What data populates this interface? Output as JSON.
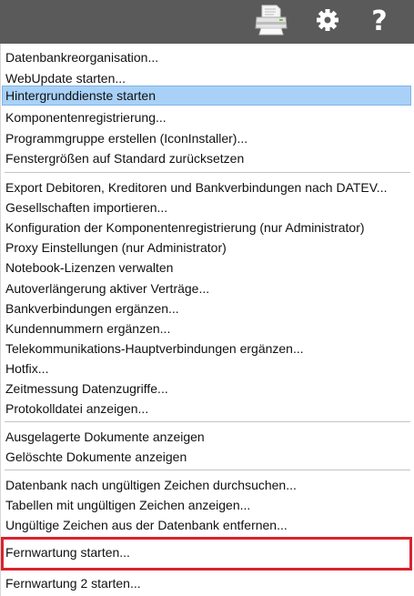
{
  "toolbar": {
    "icons": [
      "printer-icon",
      "gear-icon",
      "help-icon"
    ],
    "help_glyph": "?",
    "background": "#5a5a5a"
  },
  "menu": {
    "group1": [
      "Datenbankreorganisation...",
      "WebUpdate starten...",
      "Hintergrunddienste starten",
      "Komponentenregistrierung...",
      "Programmgruppe erstellen (IconInstaller)...",
      "Fenstergrößen auf Standard zurücksetzen"
    ],
    "group2": [
      "Export Debitoren, Kreditoren und Bankverbindungen nach DATEV...",
      "Gesellschaften importieren...",
      "Konfiguration der Komponentenregistrierung (nur Administrator)",
      "Proxy Einstellungen (nur Administrator)",
      "Notebook-Lizenzen verwalten",
      "Autoverlängerung aktiver Verträge...",
      "Bankverbindungen ergänzen...",
      "Kundennummern ergänzen...",
      "Telekommunikations-Hauptverbindungen ergänzen...",
      "Hotfix...",
      "Zeitmessung Datenzugriffe...",
      "Protokolldatei anzeigen..."
    ],
    "group3": [
      "Ausgelagerte Dokumente anzeigen",
      "Gelöschte Dokumente anzeigen"
    ],
    "group4": [
      "Datenbank nach ungültigen Zeichen durchsuchen...",
      "Tabellen mit ungültigen Zeichen anzeigen...",
      "Ungültige Zeichen aus der Datenbank entfernen..."
    ],
    "group5": [
      "Fernwartung starten..."
    ],
    "group6": [
      "Fernwartung 2 starten..."
    ],
    "selected_color": "#a9d1f7",
    "highlight_color": "#d9232e"
  }
}
